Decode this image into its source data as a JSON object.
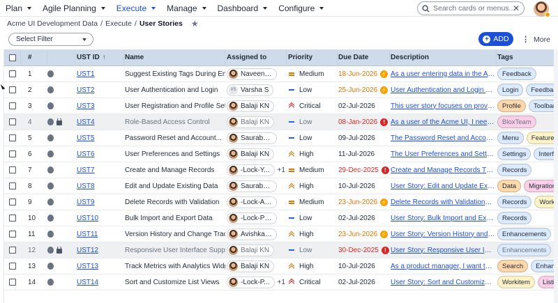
{
  "nav": {
    "items": [
      {
        "label": "Plan",
        "active": false
      },
      {
        "label": "Agile Planning",
        "active": false
      },
      {
        "label": "Execute",
        "active": true
      },
      {
        "label": "Manage",
        "active": false
      },
      {
        "label": "Dashboard",
        "active": false
      },
      {
        "label": "Configure",
        "active": false
      }
    ],
    "search_placeholder": "Search cards or menus...",
    "search_value": ""
  },
  "breadcrumb": {
    "items": [
      "Acme UI Development Data",
      "Execute",
      "User Stories"
    ],
    "separator": "/"
  },
  "toolbar": {
    "filter_label": "Select Filter",
    "add_label": "ADD",
    "more_label": "More"
  },
  "table": {
    "headers": {
      "num": "#",
      "id": "UST ID",
      "name": "Name",
      "assigned": "Assigned to",
      "priority": "Priority",
      "due": "Due Date",
      "description": "Description",
      "tags": "Tags"
    },
    "rows": [
      {
        "num": "1",
        "id": "UST1",
        "name": "Suggest Existing Tags During Entry",
        "assigned": "Naveen KM",
        "extra": "",
        "priority": "Medium",
        "prio_class": "medium",
        "due": "18-Jun-2026",
        "due_class": "due-orange",
        "due_icon": "bolt",
        "desc": "As a user entering data in the Acme UI,",
        "tags": [
          {
            "label": "Feedback",
            "color": "t-blue"
          }
        ],
        "locked": false,
        "avatar": "photo"
      },
      {
        "num": "2",
        "id": "UST2",
        "name": "User Authentication and Login",
        "assigned": "Varsha S",
        "extra": "",
        "priority": "Low",
        "prio_class": "low",
        "due": "25-Jun-2026",
        "due_class": "due-orange",
        "due_icon": "bolt",
        "desc": "User Authentication and Login The Us...",
        "tags": [
          {
            "label": "Login",
            "color": "t-blue"
          },
          {
            "label": "Feedback",
            "color": "t-blue"
          }
        ],
        "locked": false,
        "avatar": "VS"
      },
      {
        "num": "3",
        "id": "UST3",
        "name": "User Registration and Profile Setup",
        "assigned": "Balaji KN",
        "extra": "",
        "priority": "Critical",
        "prio_class": "critical",
        "due": "02-Jul-2026",
        "due_class": "",
        "due_icon": "",
        "desc": "This user story focuses on providing a...",
        "tags": [
          {
            "label": "Profile",
            "color": "t-orange"
          },
          {
            "label": "Toolbar",
            "color": "t-blue"
          }
        ],
        "locked": false,
        "avatar": "photo"
      },
      {
        "num": "4",
        "id": "UST4",
        "name": "Role-Based Access Control",
        "assigned": "Balaji KN",
        "extra": "",
        "priority": "Low",
        "prio_class": "low",
        "due": "08-Jan-2026",
        "due_class": "due-red",
        "due_icon": "alert",
        "desc": "As a user of the Acme UI, I need a role-...",
        "tags": [
          {
            "label": "BloxTeam",
            "color": "t-pink"
          }
        ],
        "locked": true,
        "avatar": "photo"
      },
      {
        "num": "5",
        "id": "UST5",
        "name": "Password Reset and Account...",
        "assigned": "Saurabh Kar",
        "extra": "",
        "priority": "Low",
        "prio_class": "low",
        "due": "09-Jul-2026",
        "due_class": "",
        "due_icon": "",
        "desc": "The Password Reset and Account Rec...",
        "tags": [
          {
            "label": "Menu",
            "color": "t-blue"
          },
          {
            "label": "Feature",
            "color": "t-yellow"
          }
        ],
        "locked": false,
        "avatar": "photo"
      },
      {
        "num": "6",
        "id": "UST6",
        "name": "User Preferences and Settings",
        "assigned": "Balaji KN",
        "extra": "",
        "priority": "High",
        "prio_class": "high",
        "due": "11-Jul-2026",
        "due_class": "",
        "due_icon": "",
        "desc": "The User Preferences and Settings fea...",
        "tags": [
          {
            "label": "Settings",
            "color": "t-blue"
          },
          {
            "label": "Interface",
            "color": "t-blue"
          }
        ],
        "locked": false,
        "avatar": "photo"
      },
      {
        "num": "7",
        "id": "UST7",
        "name": "Create and Manage Records",
        "assigned": "-Lock-Y...",
        "extra": "+1",
        "priority": "Medium",
        "prio_class": "medium",
        "due": "29-Dec-2025",
        "due_class": "due-red",
        "due_icon": "alert",
        "desc": "Create and Manage Records The user ...",
        "tags": [
          {
            "label": "Records",
            "color": "t-blue"
          }
        ],
        "locked": false,
        "avatar": "photo"
      },
      {
        "num": "8",
        "id": "UST8",
        "name": "Edit and Update Existing Data",
        "assigned": "Saurabh Kar",
        "extra": "",
        "priority": "High",
        "prio_class": "high",
        "due": "10-Jul-2026",
        "due_class": "",
        "due_icon": "",
        "desc": "User Story: Edit and Update Existing...",
        "tags": [
          {
            "label": "Data",
            "color": "t-orange"
          },
          {
            "label": "Migration",
            "color": "t-pink"
          }
        ],
        "locked": false,
        "avatar": "photo"
      },
      {
        "num": "9",
        "id": "UST9",
        "name": "Delete Records with Validation",
        "assigned": "-Lock-Akan...",
        "extra": "",
        "priority": "Medium",
        "prio_class": "medium",
        "due": "23-Jun-2026",
        "due_class": "due-orange",
        "due_icon": "bolt",
        "desc": "Delete Records with ValidationThe \"D...",
        "tags": [
          {
            "label": "Records",
            "color": "t-blue"
          },
          {
            "label": "Workitem",
            "color": "t-yellow"
          }
        ],
        "locked": false,
        "avatar": "photo"
      },
      {
        "num": "10",
        "id": "UST10",
        "name": "Bulk Import and Export Data",
        "assigned": "-Lock-Prath...",
        "extra": "",
        "priority": "Low",
        "prio_class": "low",
        "due": "02-Jul-2026",
        "due_class": "",
        "due_icon": "",
        "desc": "User Story: Bulk Import and Export D...",
        "tags": [
          {
            "label": "Records",
            "color": "t-blue"
          }
        ],
        "locked": false,
        "avatar": "photo"
      },
      {
        "num": "11",
        "id": "UST11",
        "name": "Version History and Change Tracking",
        "assigned": "Avishkar Pr...",
        "extra": "",
        "priority": "High",
        "prio_class": "high",
        "due": "23-Jun-2026",
        "due_class": "due-orange",
        "due_icon": "bolt",
        "desc": "User Story: Version History and Cha...",
        "tags": [
          {
            "label": "Enhancements",
            "color": "t-blue"
          }
        ],
        "locked": false,
        "avatar": "photo"
      },
      {
        "num": "12",
        "id": "UST12",
        "name": "Responsive User Interface Support",
        "assigned": "Balaji KN",
        "extra": "",
        "priority": "Low",
        "prio_class": "low",
        "due": "30-Dec-2025",
        "due_class": "due-red",
        "due_icon": "alert",
        "desc": "User Story: Responsive User Interface...",
        "tags": [
          {
            "label": "Enhancements",
            "color": "t-blue"
          }
        ],
        "locked": true,
        "avatar": "photo"
      },
      {
        "num": "13",
        "id": "UST13",
        "name": "Track Metrics with Analytics Widgets",
        "assigned": "Balaji KN",
        "extra": "",
        "priority": "High",
        "prio_class": "high",
        "due": "10-Jul-2026",
        "due_class": "",
        "due_icon": "",
        "desc": "As a product manager, I want to imple...",
        "tags": [
          {
            "label": "Search",
            "color": "t-orange"
          },
          {
            "label": "Enhancements",
            "color": "t-blue"
          }
        ],
        "locked": false,
        "avatar": "photo"
      },
      {
        "num": "14",
        "id": "UST14",
        "name": "Sort and Customize List Views",
        "assigned": "-Lock-P...",
        "extra": "+1",
        "priority": "Critical",
        "prio_class": "critical",
        "due": "02-Jul-2026",
        "due_class": "",
        "due_icon": "",
        "desc": "User Story: Sort and Customize List V...",
        "tags": [
          {
            "label": "Workitem",
            "color": "t-yellow"
          },
          {
            "label": "Listing",
            "color": "t-pink"
          }
        ],
        "locked": false,
        "avatar": "photo"
      }
    ]
  }
}
